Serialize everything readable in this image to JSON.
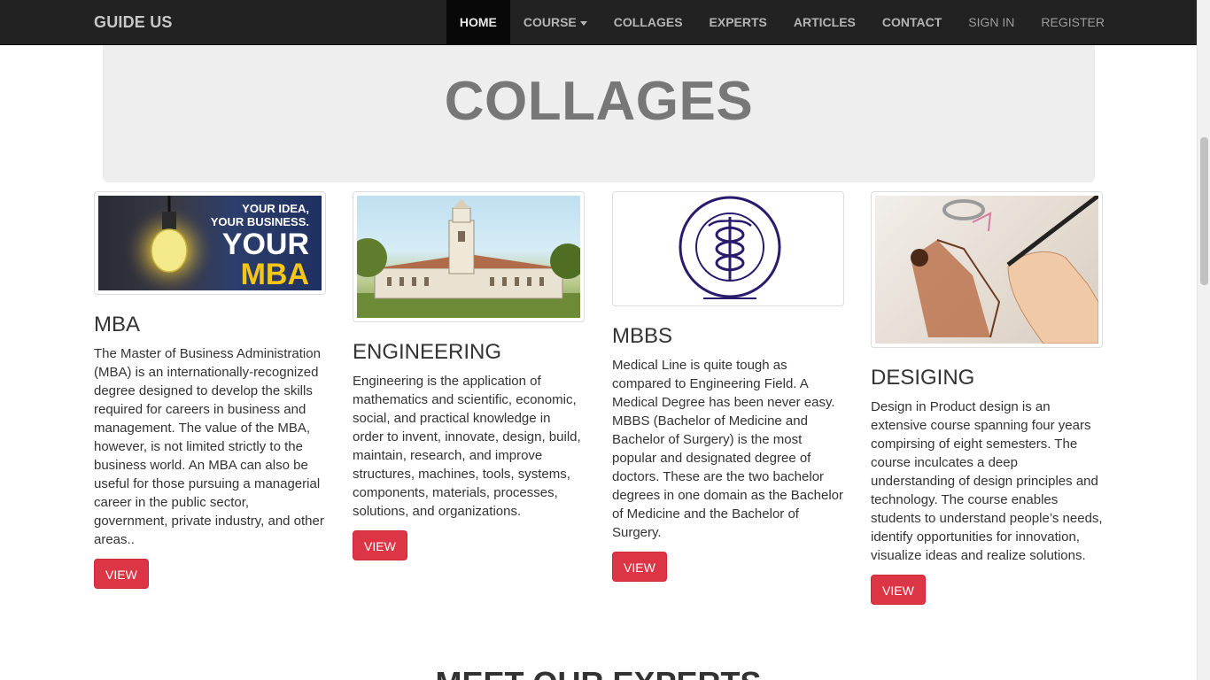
{
  "navbar": {
    "brand": "GUIDE US",
    "items": [
      {
        "label": "HOME"
      },
      {
        "label": "COURSE"
      },
      {
        "label": "COLLAGES"
      },
      {
        "label": "EXPERTS"
      },
      {
        "label": "ARTICLES"
      },
      {
        "label": "CONTACT"
      },
      {
        "label": "SIGN IN"
      },
      {
        "label": "REGISTER"
      }
    ]
  },
  "jumbotron": {
    "title": "COLLAGES"
  },
  "cards": [
    {
      "title": "MBA",
      "image_text": [
        "YOUR IDEA,",
        "YOUR BUSINESS.",
        "YOUR",
        "MBA"
      ],
      "description": "The Master of Business Administration (MBA) is an internationally-recognized degree designed to develop the skills required for careers in business and management. The value of the MBA, however, is not limited strictly to the business world. An MBA can also be useful for those pursuing a managerial career in the public sector, government, private industry, and other areas..",
      "button": "VIEW"
    },
    {
      "title": "ENGINEERING",
      "description": "Engineering is the application of mathematics and scientific, economic, social, and practical knowledge in order to invent, innovate, design, build, maintain, research, and improve structures, machines, tools, systems, components, materials, processes, solutions, and organizations.",
      "button": "VIEW"
    },
    {
      "title": "MBBS",
      "description": "Medical Line is quite tough as compared to Engineering Field. A Medical Degree has been never easy. MBBS (Bachelor of Medicine and Bachelor of Surgery) is the most popular and designated degree of doctors. These are the two bachelor degrees in one domain as the Bachelor of Medicine and the Bachelor of Surgery.",
      "button": "VIEW"
    },
    {
      "title": "DESIGING",
      "description": "Design in Product design is an extensive course spanning four years compirsing of eight semesters. The course inculcates a deep understanding of design principles and technology. The course enables students to understand people’s needs, identify opportunities for innovation, visualize ideas and realize solutions.",
      "button": "VIEW"
    }
  ],
  "experts_section": {
    "title": "MEET OUR EXPERTS"
  },
  "colors": {
    "navbar_bg": "#222222",
    "button_bg": "#dc3545",
    "jumbotron_bg": "#eeeeee"
  }
}
